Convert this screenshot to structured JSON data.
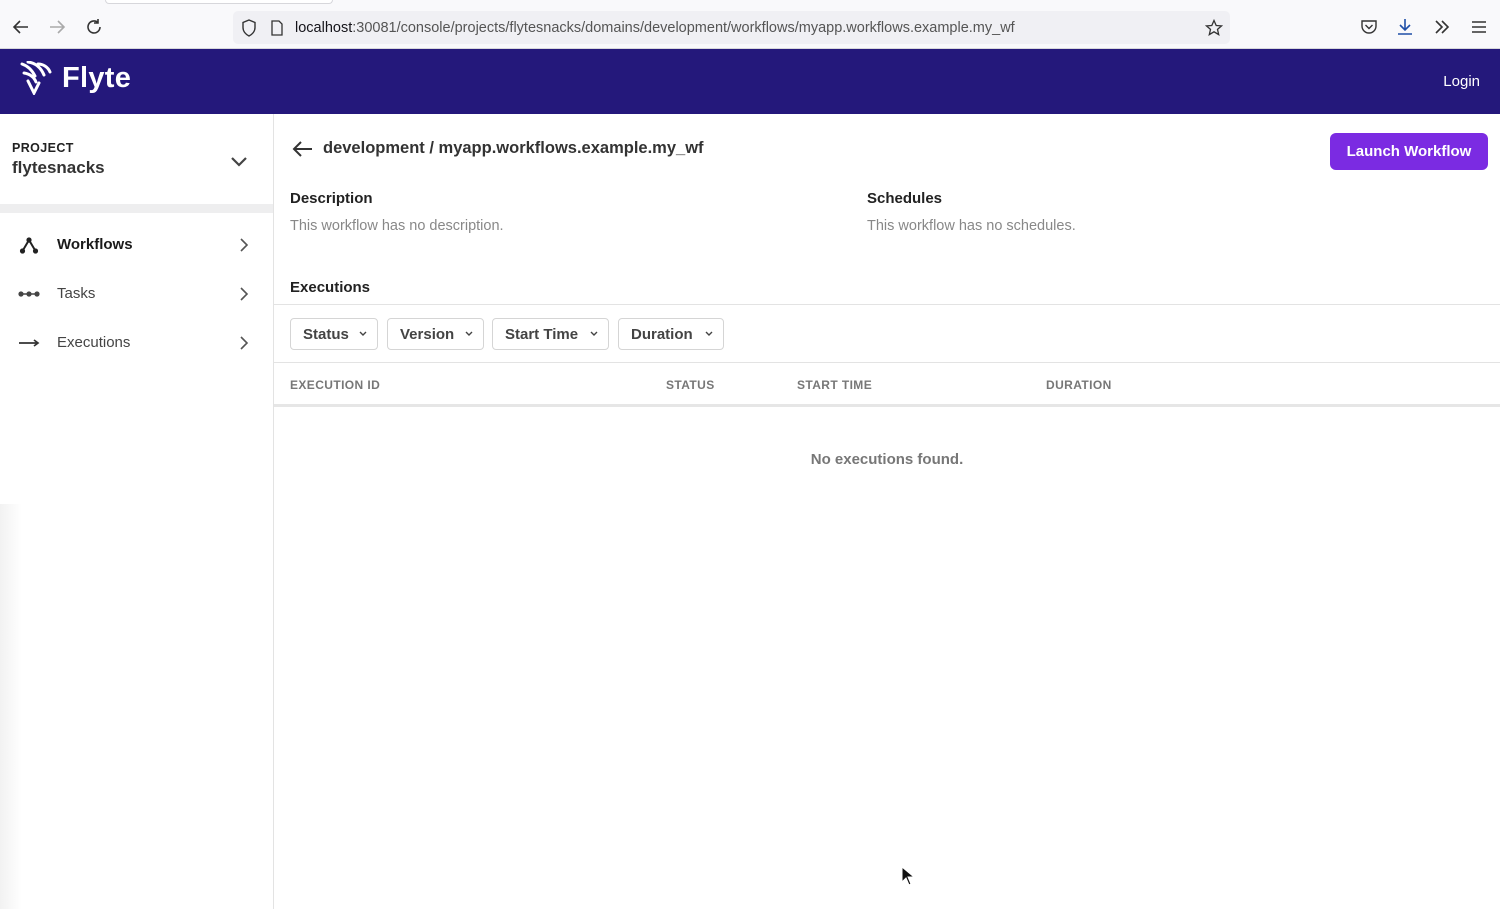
{
  "browser": {
    "url_host": "localhost",
    "url_path": ":30081/console/projects/flytesnacks/domains/development/workflows/myapp.workflows.example.my_wf"
  },
  "header": {
    "logo_text": "Flyte",
    "login_label": "Login",
    "brand_color": "#24187b"
  },
  "sidebar": {
    "project_label": "PROJECT",
    "project_name": "flytesnacks",
    "items": [
      {
        "label": "Workflows",
        "icon": "workflow-icon",
        "active": true
      },
      {
        "label": "Tasks",
        "icon": "tasks-icon",
        "active": false
      },
      {
        "label": "Executions",
        "icon": "arrow-right-icon",
        "active": false
      }
    ]
  },
  "main": {
    "breadcrumb": "development / myapp.workflows.example.my_wf",
    "launch_button": "Launch Workflow",
    "accent_color": "#7b2be2",
    "description_title": "Description",
    "description_text": "This workflow has no description.",
    "schedules_title": "Schedules",
    "schedules_text": "This workflow has no schedules.",
    "executions_title": "Executions",
    "filters": [
      "Status",
      "Version",
      "Start Time",
      "Duration"
    ],
    "columns": [
      "EXECUTION ID",
      "STATUS",
      "START TIME",
      "DURATION"
    ],
    "empty_message": "No executions found."
  }
}
